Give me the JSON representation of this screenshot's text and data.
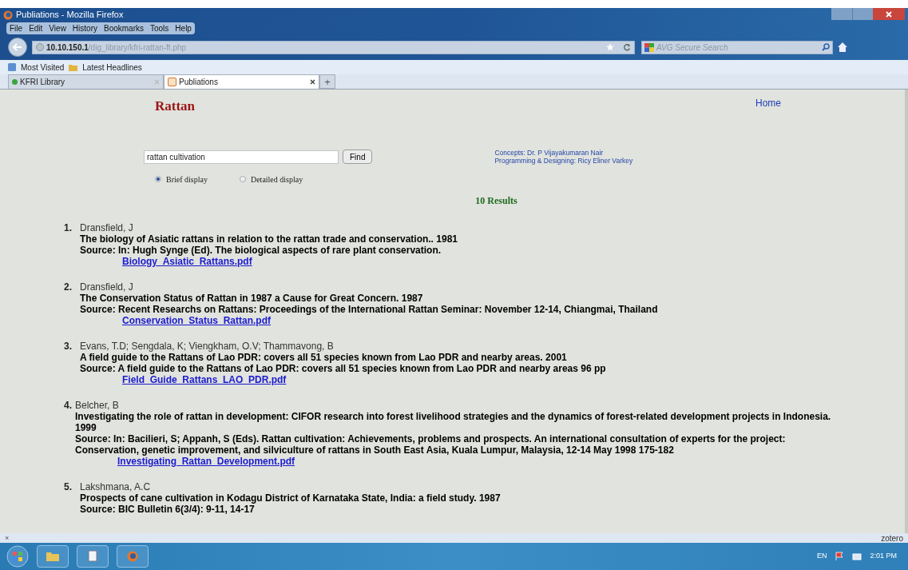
{
  "window": {
    "title": "Publiations - Mozilla Firefox"
  },
  "menu": [
    "File",
    "Edit",
    "View",
    "History",
    "Bookmarks",
    "Tools",
    "Help"
  ],
  "address": {
    "host": "10.10.150.1",
    "path": "/dig_library/kfri-rattan-ft.php"
  },
  "web_search": {
    "placeholder": "AVG Secure Search"
  },
  "bookmarks": [
    "Most Visited",
    "Latest Headlines"
  ],
  "tabs": [
    {
      "label": "KFRI Library",
      "selected": false
    },
    {
      "label": "Publiations",
      "selected": true
    }
  ],
  "new_tab": "+",
  "page": {
    "heading": "Rattan",
    "home_link": "Home",
    "search": {
      "value": "rattan cultivation",
      "button": "Find"
    },
    "display_options": [
      {
        "label": "Brief display",
        "selected": true
      },
      {
        "label": "Detailed display",
        "selected": false
      }
    ],
    "credits": [
      "Concepts: Dr. P Vijayakumaran Nair",
      "Programming & Designing: Ricy Eliner Varkey"
    ],
    "results_count": "10 Results",
    "results": [
      {
        "number": "1.",
        "authors": "Dransfield, J",
        "title": "The biology of Asiatic rattans in relation to the rattan trade and conservation.. 1981",
        "source": "Source: In: Hugh Synge (Ed). The biological aspects of rare plant conservation.",
        "file": "Biology_Asiatic_Rattans.pdf"
      },
      {
        "number": "2.",
        "authors": "Dransfield, J",
        "title": "The Conservation Status of Rattan in 1987 a Cause for Great Concern. 1987",
        "source": "Source: Recent Researchs on Rattans: Proceedings of the International Rattan Seminar: November 12-14, Chiangmai, Thailand",
        "file": "Conservation_Status_Rattan.pdf"
      },
      {
        "number": "3.",
        "authors": "Evans, T.D; Sengdala, K; Viengkham, O.V; Thammavong, B",
        "title": "A field guide to the Rattans of Lao PDR: covers all 51 species known from Lao PDR and nearby areas. 2001",
        "source": "Source: A field guide to the Rattans of Lao PDR: covers all 51 species known from Lao PDR and nearby areas 96 pp",
        "file": "Field_Guide_Rattans_LAO_PDR.pdf"
      },
      {
        "number": "4.",
        "authors": "Belcher, B",
        "title": "Investigating the role of rattan in development: CIFOR research into forest livelihood strategies and the dynamics of forest-related development projects in Indonesia. 1999",
        "source": "Source: In: Bacilieri, S; Appanh, S (Eds). Rattan cultivation: Achievements, problems and prospects. An international consultation of experts for the project: Conservation, genetic improvement, and silviculture of rattans in South East Asia, Kuala Lumpur, Malaysia, 12-14 May 1998 175-182",
        "file": "Investigating_Rattan_Development.pdf"
      },
      {
        "number": "5.",
        "authors": "Lakshmana, A.C",
        "title": "Prospects of cane cultivation in Kodagu District of Karnataka State, India: a field study. 1987",
        "source": "Source: BIC Bulletin 6(3/4): 9-11, 14-17"
      }
    ]
  },
  "addon_bar": {
    "close": "×",
    "label": "zotero"
  },
  "taskbar": {
    "language": "EN",
    "time": "2:01 PM"
  }
}
